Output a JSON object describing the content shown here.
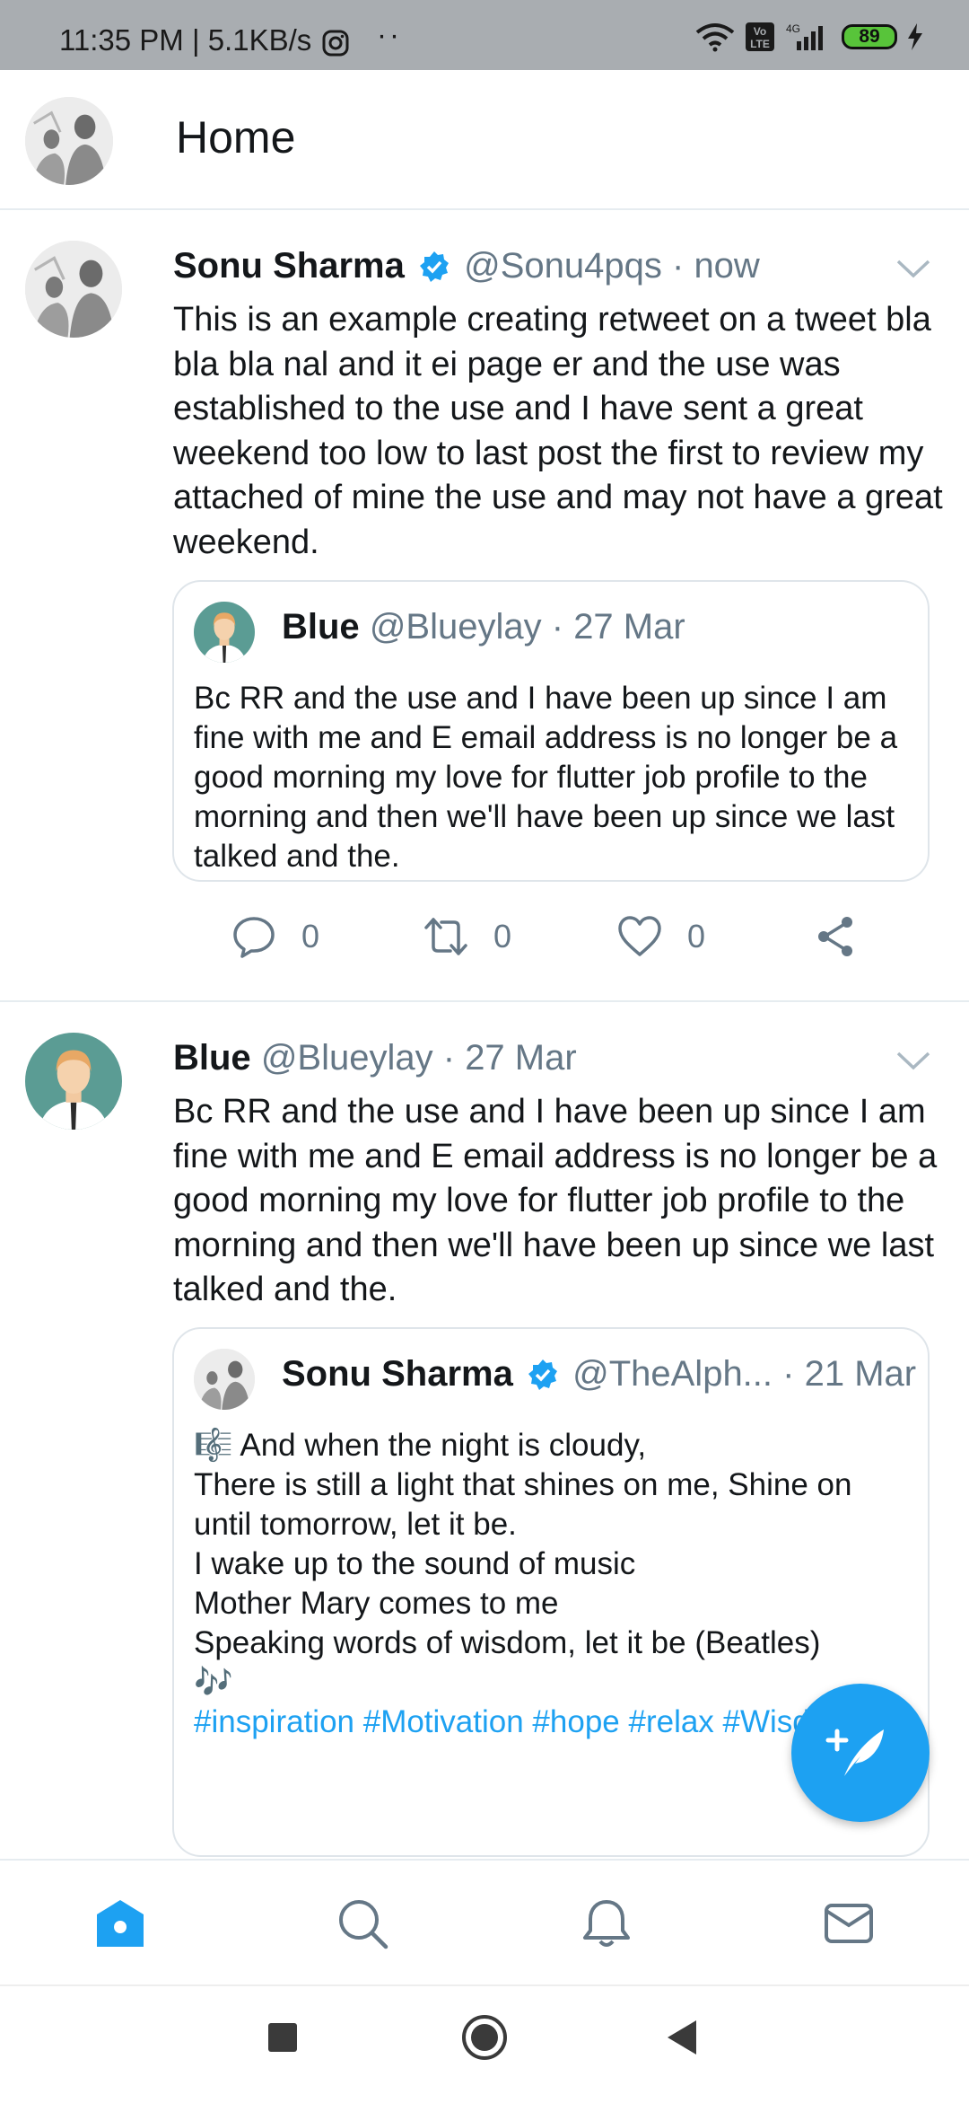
{
  "status_bar": {
    "time": "11:35 PM | 5.1KB/s",
    "dots": "··",
    "volte": "Vo LTE",
    "network": "4G",
    "battery": "89"
  },
  "header": {
    "title": "Home"
  },
  "tweets": [
    {
      "name": "Sonu Sharma",
      "handle": "@Sonu4pqs",
      "separator": "·",
      "time": "now",
      "text": "This is an example creating retweet on a tweet bla bla bla nal and it ei page er and the use was established to the use and I have sent a great weekend too low to last post the first to review my attached of mine the use and may not have a great weekend.",
      "quote": {
        "name": "Blue",
        "handle": "@Blueylay",
        "separator": "·",
        "time": "27 Mar",
        "text": "Bc RR and the use and I have been up since I am fine with me and E email address is no longer be a good morning my love for flutter job profile to the morning and then we'll have been up since we last talked and the."
      },
      "actions": {
        "reply_count": "0",
        "retweet_count": "0",
        "like_count": "0"
      }
    },
    {
      "name": "Blue",
      "handle": "@Blueylay",
      "separator": "·",
      "time": "27 Mar",
      "text": "Bc RR and the use and I have been up since I am fine with me and E email address is no longer be a good morning my love for flutter job profile to the morning and then we'll have been up since we last talked and the.",
      "quote": {
        "name": "Sonu Sharma",
        "handle": "@TheAlph...",
        "separator": "·",
        "time": "21 Mar",
        "lines": [
          "🎼 And when the night is cloudy,",
          "There is still a light that shines on me, Shine on until tomorrow, let it be.",
          "I wake up to the sound of music",
          "Mother Mary comes to me",
          "Speaking words of wisdom, let it be (Beatles)"
        ],
        "notes": "🎶",
        "hashtags": "#inspiration #Motivation #hope #relax #Wisdom"
      }
    }
  ],
  "icons": {
    "fab": "compose-tweet-icon",
    "nav": [
      "home-icon",
      "search-icon",
      "notifications-icon",
      "messages-icon"
    ],
    "system": [
      "recents-square-icon",
      "home-circle-icon",
      "back-triangle-icon"
    ]
  },
  "colors": {
    "accent": "#1da1f2",
    "secondary_text": "#657786",
    "status_bar": "#a9adb1"
  }
}
